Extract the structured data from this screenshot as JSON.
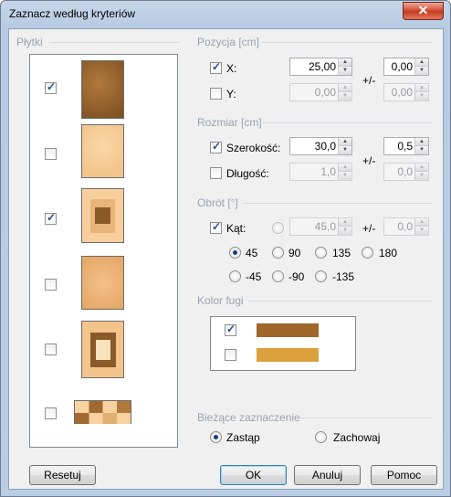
{
  "window": {
    "title": "Zaznacz według kryteriów",
    "close_label": "✕"
  },
  "tiles": {
    "label": "Płytki",
    "items": [
      {
        "checked": true
      },
      {
        "checked": false
      },
      {
        "checked": true
      },
      {
        "checked": false
      },
      {
        "checked": false
      },
      {
        "checked": false
      }
    ]
  },
  "position": {
    "label": "Pozycja [cm]",
    "x": {
      "label": "X:",
      "checked": true,
      "value": "25,00",
      "tolerance": "0,00"
    },
    "y": {
      "label": "Y:",
      "checked": false,
      "value": "0,00",
      "tolerance": "0,00"
    },
    "plusminus": "+/-"
  },
  "size": {
    "label": "Rozmiar [cm]",
    "width": {
      "label": "Szerokość:",
      "checked": true,
      "value": "30,0",
      "tolerance": "0,5"
    },
    "length": {
      "label": "Długość:",
      "checked": false,
      "value": "1,0",
      "tolerance": "0,0"
    },
    "plusminus": "+/-"
  },
  "rotation": {
    "label": "Obrót [°]",
    "angle": {
      "label": "Kąt:",
      "checked": true,
      "value": "45,0",
      "tolerance": "0,0"
    },
    "plusminus": "+/-",
    "options_row1": [
      "45",
      "90",
      "135",
      "180"
    ],
    "options_row2": [
      "-45",
      "-90",
      "-135"
    ],
    "selected": "45"
  },
  "joint_color": {
    "label": "Kolor fugi",
    "items": [
      {
        "checked": true,
        "color": "#a0662a"
      },
      {
        "checked": false,
        "color": "#dca03c"
      }
    ]
  },
  "current_selection": {
    "label": "Bieżące zaznaczenie",
    "replace_label": "Zastąp",
    "keep_label": "Zachowaj",
    "selected": "replace"
  },
  "buttons": {
    "reset": "Resetuj",
    "ok": "OK",
    "cancel": "Anuluj",
    "help": "Pomoc"
  }
}
